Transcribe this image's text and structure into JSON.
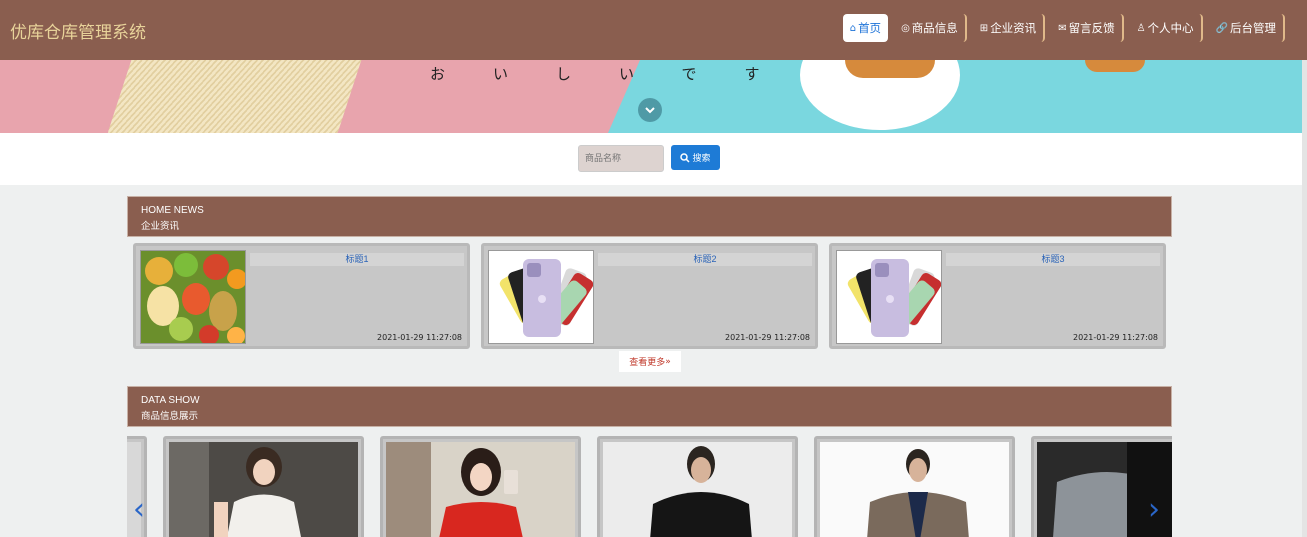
{
  "app": {
    "title": "优库仓库管理系统"
  },
  "nav": [
    {
      "label": "首页",
      "icon": "home-icon"
    },
    {
      "label": "商品信息",
      "icon": "globe-icon"
    },
    {
      "label": "企业资讯",
      "icon": "grid-icon"
    },
    {
      "label": "留言反馈",
      "icon": "mail-icon"
    },
    {
      "label": "个人中心",
      "icon": "user-icon"
    },
    {
      "label": "后台管理",
      "icon": "link-icon"
    }
  ],
  "banner": {
    "text": "おいしいです"
  },
  "search": {
    "placeholder": "商品名称",
    "button_label": "搜索"
  },
  "news_section": {
    "title_en": "HOME NEWS",
    "title_cn": "企业资讯"
  },
  "news": [
    {
      "title": "标题1",
      "date": "2021-01-29 11:27:08",
      "image": "fruit"
    },
    {
      "title": "标题2",
      "date": "2021-01-29 11:27:08",
      "image": "phone"
    },
    {
      "title": "标题3",
      "date": "2021-01-29 11:27:08",
      "image": "phone"
    }
  ],
  "more_label": "查看更多",
  "data_section": {
    "title_en": "DATA SHOW",
    "title_cn": "商品信息展示"
  },
  "products": [
    {
      "image": "white-dress"
    },
    {
      "image": "red-top"
    },
    {
      "image": "black-tshirt"
    },
    {
      "image": "blazer"
    },
    {
      "image": "grey-jacket"
    }
  ],
  "colors": {
    "brand": "#8a5e4f",
    "accent": "#1e7bd6",
    "title": "#e8d39a"
  }
}
